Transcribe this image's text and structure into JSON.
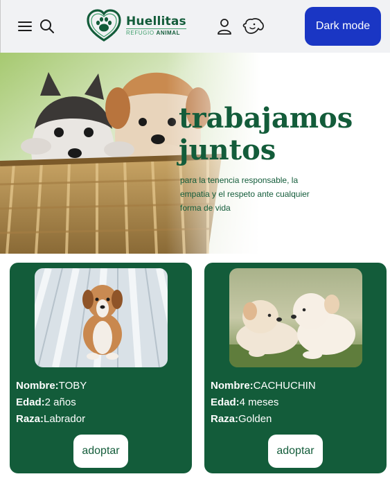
{
  "header": {
    "menu_icon": "hamburger-menu-icon",
    "search_icon": "search-icon",
    "logo_title": "Huellitas",
    "logo_sub_1": "REFUGIO ",
    "logo_sub_2": "ANIMAL",
    "user_icon": "user-icon",
    "pet_icon": "dog-icon",
    "dark_mode_label": "Dark mode"
  },
  "hero": {
    "title": "trabajamos juntos",
    "text": "para la tenencia responsable, la empatia y el respeto ante cualquier forma de vida"
  },
  "pets": [
    {
      "name_label": "Nombre:",
      "name": "TOBY",
      "age_label": "Edad:",
      "age": "2 años",
      "breed_label": "Raza:",
      "breed": "Labrador",
      "button": "adoptar"
    },
    {
      "name_label": "Nombre:",
      "name": "CACHUCHIN",
      "age_label": "Edad:",
      "age": "4 meses",
      "breed_label": "Raza:",
      "breed": "Golden",
      "button": "adoptar"
    }
  ],
  "colors": {
    "brand_green": "#135c3a",
    "button_blue": "#1a36c4",
    "header_bg": "#f1f2f4"
  }
}
